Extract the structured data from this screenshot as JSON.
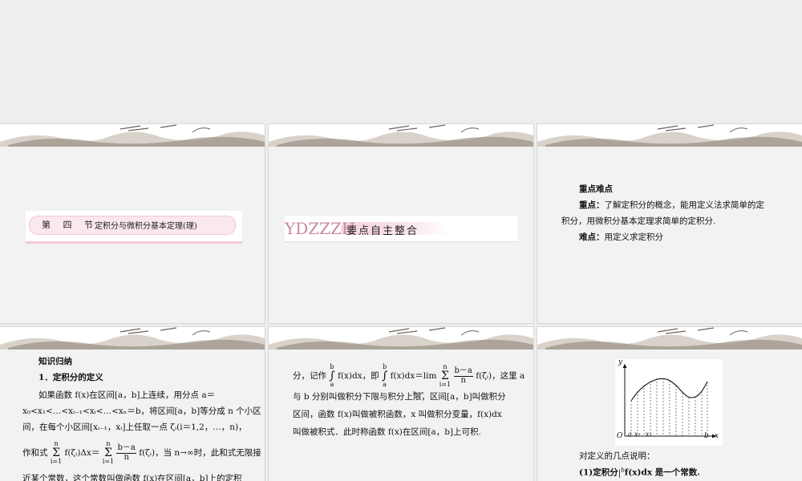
{
  "slides": {
    "s1": {
      "chapter": "第 四 节",
      "topic": "定积分与微积分基本定理(理)"
    },
    "s2": {
      "code": "YDZZZH",
      "section": "要点自主整合"
    },
    "s3": {
      "heading": "重点难点",
      "key_label": "重点：",
      "key_text_1": "了解定积分的概念，能用定义法求简单的定",
      "key_text_2": "积分，用微积分基本定理求简单的定积分.",
      "diff_label": "难点：",
      "diff_text": "用定义求定积分"
    },
    "s4": {
      "heading": "知识归纳",
      "sub": "1．定积分的定义",
      "l1": "如果函数 f(x)在区间[a，b]上连续，用分点 a＝",
      "l2": "x₀<x₁<…<xᵢ₋₁<xᵢ<…<xₙ＝b，将区间[a，b]等分成 n 个小区",
      "l3": "间，在每个小区间[xᵢ₋₁，xᵢ]上任取一点 ζᵢ(i＝1,2，…，n)，",
      "l4_pre": "作和式",
      "l4_mid": "f(ζᵢ)Δx＝",
      "l4_post": "f(ζᵢ)，当 n→∞时，此和式无限接",
      "sum_top": "n",
      "sum_bot": "i=1",
      "frac_num": "b－a",
      "frac_den": "n",
      "l5": "近某个常数，这个常数叫做函数 f(x)在区间[a，b]上的定积"
    },
    "s5": {
      "l1_pre": "分，记作",
      "l1_int": "f(x)dx，即",
      "l1_eq": "f(x)dx＝lim",
      "l1_post": "f(ζᵢ)，这里 a",
      "int_top": "b",
      "int_bot": "a",
      "lim_sub": "n→∞",
      "sum_top": "n",
      "sum_bot": "i=1",
      "frac_num": "b－a",
      "frac_den": "n",
      "l2": "与 b 分别叫做积分下限与积分上限，区间[a，b]叫做积分",
      "l3": "区间，函数 f(x)叫做被积函数，x 叫做积分变量，f(x)dx",
      "l4": "叫做被积式．此时称函数 f(x)在区间[a，b]上可积."
    },
    "s6": {
      "axis_y": "y",
      "axis_x": "x",
      "origin": "O",
      "lbl_a": "a",
      "lbl_x1": "x₁",
      "lbl_x2": "x₂",
      "lbl_b": "b",
      "note": "对定义的几点说明：",
      "item1_pre": "(1)定积分",
      "item1_int_top": "b",
      "item1_post": "f(x)dx 是一个常数."
    }
  }
}
